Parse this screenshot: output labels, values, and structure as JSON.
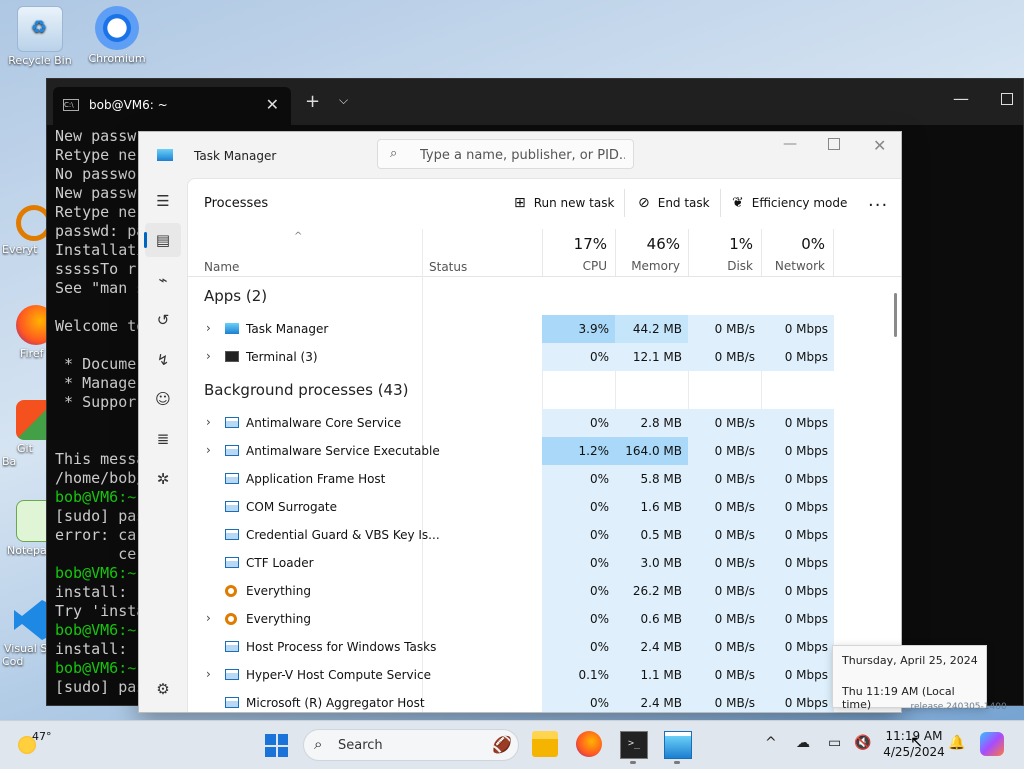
{
  "desktop": {
    "icons": [
      {
        "label": "Recycle Bin"
      },
      {
        "label": "Chromium"
      }
    ],
    "partial_icons": [
      {
        "label": "Everyt"
      },
      {
        "label": "Firef"
      },
      {
        "label": "Git Ba"
      },
      {
        "label": "Notepa"
      },
      {
        "label": "Visual S Cod"
      }
    ]
  },
  "terminal": {
    "tab_title": "bob@VM6: ~",
    "lines": [
      "New passw",
      "Retype ne",
      "No passwo",
      "New passw",
      "Retype ne",
      "passwd: pa",
      "Installati",
      "sssssTo r",
      "See \"man s",
      "",
      "Welcome to",
      "",
      " * Docume",
      " * Manage",
      " * Suppor",
      "",
      "",
      "This messa",
      "/home/bob/",
      "bob@VM6:~",
      "[sudo] pas",
      "error: ca",
      "       ce",
      "bob@VM6:~",
      "install: ",
      "Try 'insta",
      "bob@VM6:~",
      "install: ",
      "bob@VM6:~",
      "[sudo] pas"
    ]
  },
  "taskmgr": {
    "title": "Task Manager",
    "search_placeholder": "Type a name, publisher, or PID...",
    "page_title": "Processes",
    "toolbar": {
      "run_new_task": "Run new task",
      "end_task": "End task",
      "efficiency_mode": "Efficiency mode",
      "more": "..."
    },
    "columns": {
      "name": "Name",
      "status": "Status",
      "cpu_pct": "17%",
      "cpu": "CPU",
      "memory_pct": "46%",
      "memory": "Memory",
      "disk_pct": "1%",
      "disk": "Disk",
      "network_pct": "0%",
      "network": "Network"
    },
    "apps_group": "Apps (2)",
    "bg_group": "Background processes (43)",
    "apps": [
      {
        "name": "Task Manager",
        "cpu": "3.9%",
        "memory": "44.2 MB",
        "disk": "0 MB/s",
        "network": "0 Mbps"
      },
      {
        "name": "Terminal (3)",
        "cpu": "0%",
        "memory": "12.1 MB",
        "disk": "0 MB/s",
        "network": "0 Mbps"
      }
    ],
    "background": [
      {
        "name": "Antimalware Core Service",
        "cpu": "0%",
        "memory": "2.8 MB",
        "disk": "0 MB/s",
        "network": "0 Mbps"
      },
      {
        "name": "Antimalware Service Executable",
        "cpu": "1.2%",
        "memory": "164.0 MB",
        "disk": "0 MB/s",
        "network": "0 Mbps"
      },
      {
        "name": "Application Frame Host",
        "cpu": "0%",
        "memory": "5.8 MB",
        "disk": "0 MB/s",
        "network": "0 Mbps"
      },
      {
        "name": "COM Surrogate",
        "cpu": "0%",
        "memory": "1.6 MB",
        "disk": "0 MB/s",
        "network": "0 Mbps"
      },
      {
        "name": "Credential Guard & VBS Key Is...",
        "cpu": "0%",
        "memory": "0.5 MB",
        "disk": "0 MB/s",
        "network": "0 Mbps"
      },
      {
        "name": "CTF Loader",
        "cpu": "0%",
        "memory": "3.0 MB",
        "disk": "0 MB/s",
        "network": "0 Mbps"
      },
      {
        "name": "Everything",
        "cpu": "0%",
        "memory": "26.2 MB",
        "disk": "0 MB/s",
        "network": "0 Mbps"
      },
      {
        "name": "Everything",
        "cpu": "0%",
        "memory": "0.6 MB",
        "disk": "0 MB/s",
        "network": "0 Mbps"
      },
      {
        "name": "Host Process for Windows Tasks",
        "cpu": "0%",
        "memory": "2.4 MB",
        "disk": "0 MB/s",
        "network": "0 Mbps"
      },
      {
        "name": "Hyper-V Host Compute Service",
        "cpu": "0.1%",
        "memory": "1.1 MB",
        "disk": "0 MB/s",
        "network": "0 Mbps"
      },
      {
        "name": "Microsoft (R) Aggregator Host",
        "cpu": "0%",
        "memory": "2.4 MB",
        "disk": "0 MB/s",
        "network": "0 Mbps"
      }
    ]
  },
  "tooltip": {
    "date_line": "Thursday, April 25, 2024",
    "time_line": "Thu 11:19 AM (Local time)"
  },
  "watermark": "_release.240305-1400",
  "taskbar": {
    "weather_temp": "47°",
    "search_label": "Search",
    "clock_time": "11:19 AM",
    "clock_date": "4/25/2024"
  },
  "colors": {
    "accent": "#0067c0",
    "heat_low": "#dff0fc",
    "heat_mid": "#c5e5fb",
    "heat_high": "#a9d8f8"
  }
}
